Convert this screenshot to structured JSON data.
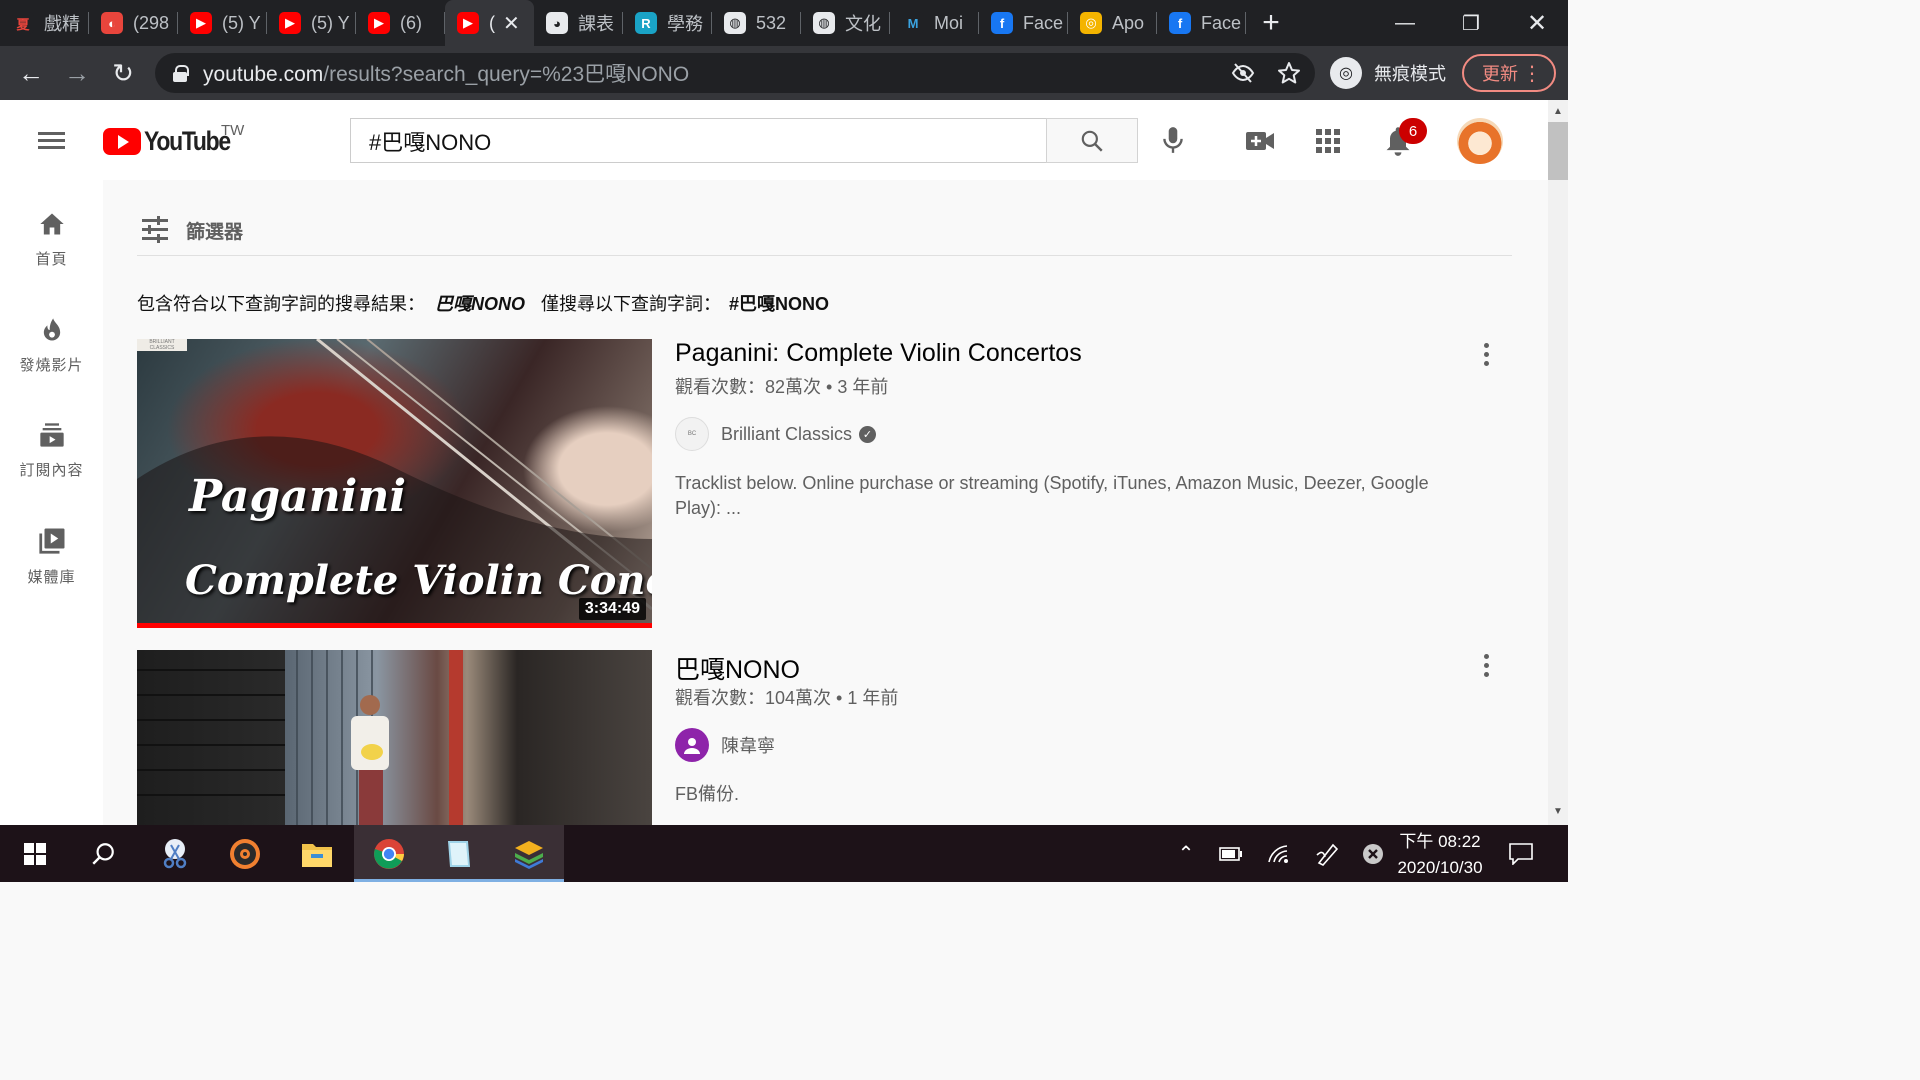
{
  "browser": {
    "tabs": [
      {
        "title": "戲精",
        "fav_color": "#202124",
        "fav_text": "夏",
        "fav_text_color": "#e8453c"
      },
      {
        "title": "(298",
        "fav_color": "#e8453c",
        "fav_text": "◐"
      },
      {
        "title": "(5) Y",
        "fav_color": "#ff0000",
        "fav_text": "▶"
      },
      {
        "title": "(5) Y",
        "fav_color": "#ff0000",
        "fav_text": "▶"
      },
      {
        "title": "(6)",
        "fav_color": "#ff0000",
        "fav_text": "▶"
      },
      {
        "title": "(",
        "fav_color": "#ff0000",
        "fav_text": "▶",
        "active": true
      },
      {
        "title": "課表",
        "fav_color": "#e8eaed",
        "fav_text": "◕",
        "fav_text_color": "#202124"
      },
      {
        "title": "學務",
        "fav_color": "#1aa3c6",
        "fav_text": "R"
      },
      {
        "title": "532",
        "fav_color": "#e8eaed",
        "fav_text": "◍",
        "fav_text_color": "#202124"
      },
      {
        "title": "文化",
        "fav_color": "#e8eaed",
        "fav_text": "◍",
        "fav_text_color": "#202124"
      },
      {
        "title": "Moi",
        "fav_color": "#202124",
        "fav_text": "M",
        "fav_text_color": "#3aa3e0"
      },
      {
        "title": "Face",
        "fav_color": "#1877f2",
        "fav_text": "f"
      },
      {
        "title": "Apo",
        "fav_color": "#f4b400",
        "fav_text": "◎"
      },
      {
        "title": "Face",
        "fav_color": "#1877f2",
        "fav_text": "f"
      }
    ],
    "url_host": "youtube.com",
    "url_path": "/results?search_query=%23巴嘎NONO",
    "incognito_label": "無痕模式",
    "update_label": "更新"
  },
  "youtube": {
    "region": "TW",
    "logo_word": "YouTube",
    "search_value": "#巴嘎NONO",
    "notification_count": "6",
    "sidebar": [
      {
        "label": "首頁",
        "icon": "home-icon"
      },
      {
        "label": "發燒影片",
        "icon": "fire-icon"
      },
      {
        "label": "訂閱內容",
        "icon": "subscriptions-icon"
      },
      {
        "label": "媒體庫",
        "icon": "library-icon"
      }
    ],
    "filter_label": "篩選器",
    "spell": {
      "prefix": "包含符合以下查詢字詞的搜尋結果：",
      "query": "巴嘎NONO",
      "only_prefix": "僅搜尋以下查詢字詞：",
      "exact_query": "#巴嘎NONO"
    },
    "results": [
      {
        "title": "Paganini: Complete Violin Concertos",
        "meta": "觀看次數：82萬次 • 3 年前",
        "channel": "Brilliant Classics",
        "verified": true,
        "description": "Tracklist below. Online purchase or streaming (Spotify, iTunes, Amazon Music, Deezer, Google Play): ...",
        "duration": "3:34:49",
        "thumb_line1": "Paganini",
        "thumb_line2": "Complete Violin Concertos",
        "badge_text": "BRILLIANT CLASSICS",
        "watched_fraction": 1
      },
      {
        "title": "巴嘎NONO",
        "meta": "觀看次數：104萬次 • 1 年前",
        "channel": "陳韋寧",
        "verified": false,
        "description": "FB備份."
      }
    ]
  },
  "taskbar": {
    "time": "下午 08:22",
    "date": "2020/10/30"
  },
  "colors": {
    "yt_red": "#ff0000",
    "chrome_dark": "#202124",
    "chrome_toolbar": "#35363a",
    "update_pink": "#f28b82",
    "taskbar": "#1d1218"
  }
}
